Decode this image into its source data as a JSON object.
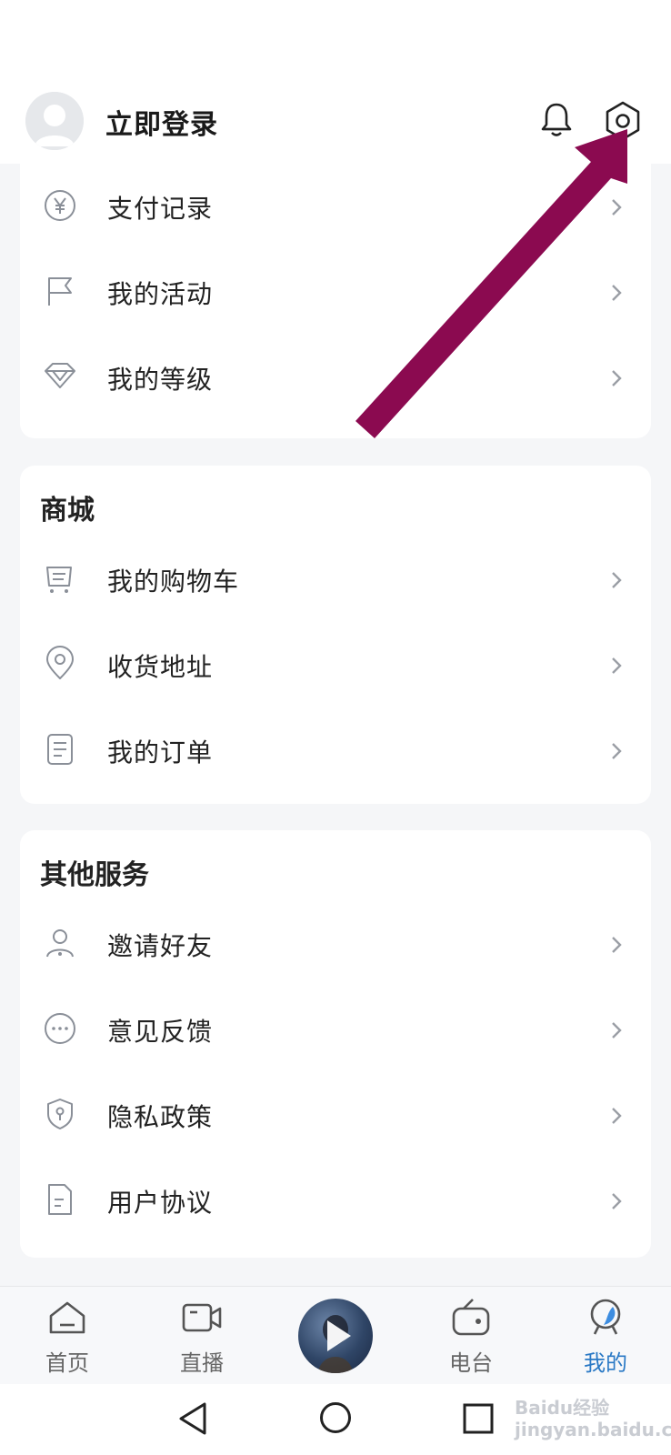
{
  "header": {
    "login_label": "立即登录",
    "avatar_icon": "user-avatar-icon",
    "bell_icon": "bell-icon",
    "settings_icon": "settings-gear-icon"
  },
  "account_section": {
    "items": [
      {
        "label": "支付记录",
        "icon": "yen-coin-icon"
      },
      {
        "label": "我的活动",
        "icon": "flag-icon"
      },
      {
        "label": "我的等级",
        "icon": "diamond-icon"
      }
    ]
  },
  "mall_section": {
    "title": "商城",
    "items": [
      {
        "label": "我的购物车",
        "icon": "cart-icon"
      },
      {
        "label": "收货地址",
        "icon": "location-pin-icon"
      },
      {
        "label": "我的订单",
        "icon": "order-list-icon"
      }
    ]
  },
  "services_section": {
    "title": "其他服务",
    "items": [
      {
        "label": "邀请好友",
        "icon": "user-icon"
      },
      {
        "label": "意见反馈",
        "icon": "chat-bubble-icon"
      },
      {
        "label": "隐私政策",
        "icon": "shield-icon"
      },
      {
        "label": "用户协议",
        "icon": "document-icon"
      }
    ]
  },
  "tabbar": {
    "tabs": [
      {
        "label": "首页",
        "icon": "home-icon"
      },
      {
        "label": "直播",
        "icon": "video-camera-icon"
      },
      {
        "label": "",
        "icon": "play-icon"
      },
      {
        "label": "电台",
        "icon": "radio-icon"
      },
      {
        "label": "我的",
        "icon": "profile-icon"
      }
    ],
    "active_color": "#2a79c5"
  },
  "system_nav": {
    "back_icon": "triangle-back-icon",
    "home_icon": "circle-home-icon",
    "recents_icon": "square-recents-icon"
  },
  "watermark": "Baidu经验 jingyan.baidu.com",
  "annotation_arrow_color": "#8b0a50"
}
